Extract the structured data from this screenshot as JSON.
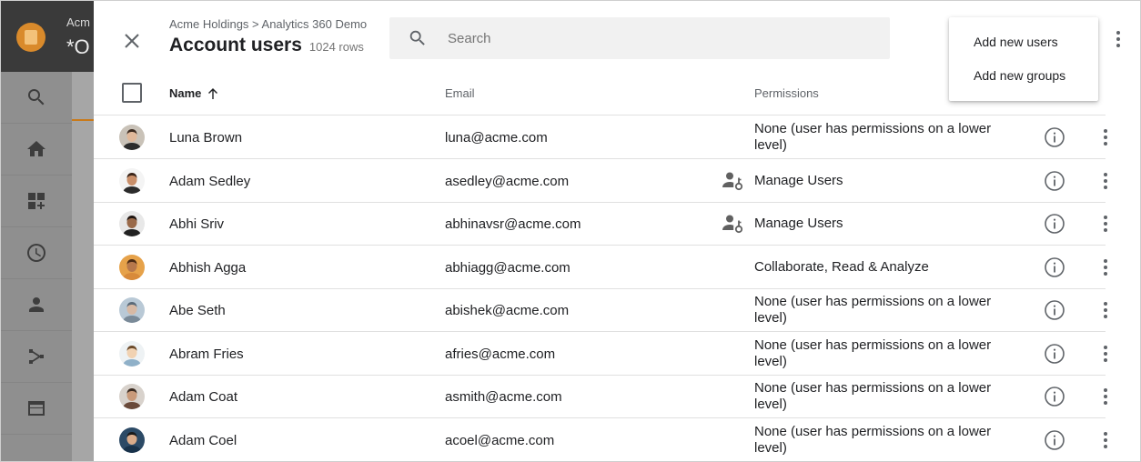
{
  "background": {
    "account_text": "Acm",
    "property_text": "*O"
  },
  "panel": {
    "breadcrumb": "Acme Holdings > Analytics 360 Demo",
    "title": "Account users",
    "row_count": "1024 rows",
    "search_placeholder": "Search"
  },
  "menu": {
    "items": [
      "Add new users",
      "Add new groups"
    ]
  },
  "table": {
    "columns": {
      "name": "Name",
      "email": "Email",
      "permissions": "Permissions"
    },
    "rows": [
      {
        "name": "Luna Brown",
        "email": "luna@acme.com",
        "permissions": "None (user has permissions on a lower level)",
        "manage_icon": false
      },
      {
        "name": "Adam Sedley",
        "email": "asedley@acme.com",
        "permissions": "Manage Users",
        "manage_icon": true
      },
      {
        "name": "Abhi Sriv",
        "email": "abhinavsr@acme.com",
        "permissions": "Manage Users",
        "manage_icon": true
      },
      {
        "name": "Abhish Agga",
        "email": "abhiagg@acme.com",
        "permissions": "Collaborate, Read & Analyze",
        "manage_icon": false
      },
      {
        "name": "Abe Seth",
        "email": "abishek@acme.com",
        "permissions": "None (user has permissions on a lower level)",
        "manage_icon": false
      },
      {
        "name": "Abram Fries",
        "email": "afries@acme.com",
        "permissions": "None (user has permissions on a lower level)",
        "manage_icon": false
      },
      {
        "name": "Adam Coat",
        "email": "asmith@acme.com",
        "permissions": "None (user has permissions on a lower level)",
        "manage_icon": false
      },
      {
        "name": "Adam Coel",
        "email": "acoel@acme.com",
        "permissions": "None (user has permissions on a lower level)",
        "manage_icon": false
      }
    ]
  },
  "colors": {
    "text_primary": "#202124",
    "text_secondary": "#5f6368",
    "divider": "#e0e0e0",
    "search_bg": "#f1f1f1",
    "rail_bg": "#8f8f8f",
    "topbar_bg": "#3a3a3a",
    "brand_orange": "#d98a2b"
  },
  "icons": {
    "close": "close-icon",
    "search": "search-icon",
    "sort": "arrow-up-icon",
    "info": "info-icon",
    "more": "more-vert-icon",
    "manage_users": "manage-users-icon"
  }
}
